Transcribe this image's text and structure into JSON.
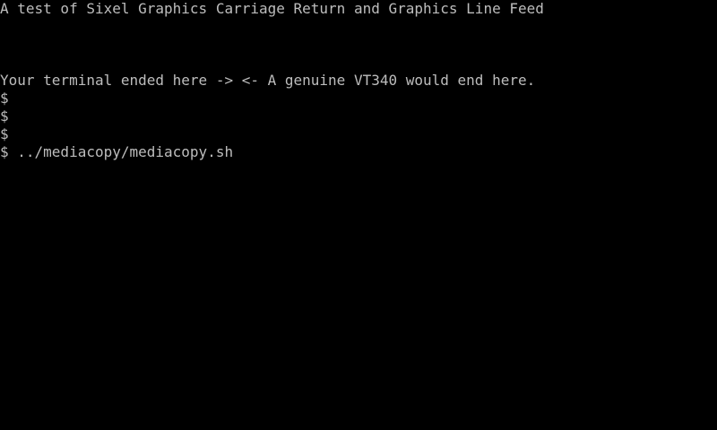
{
  "terminal": {
    "background": "#000000",
    "foreground": "#bdbdbd",
    "lines": [
      "A test of Sixel Graphics Carriage Return and Graphics Line Feed",
      "Your terminal ended here -> <- A genuine VT340 would end here.",
      "$",
      "$",
      "$",
      "$ ../mediacopy/mediacopy.sh"
    ]
  }
}
